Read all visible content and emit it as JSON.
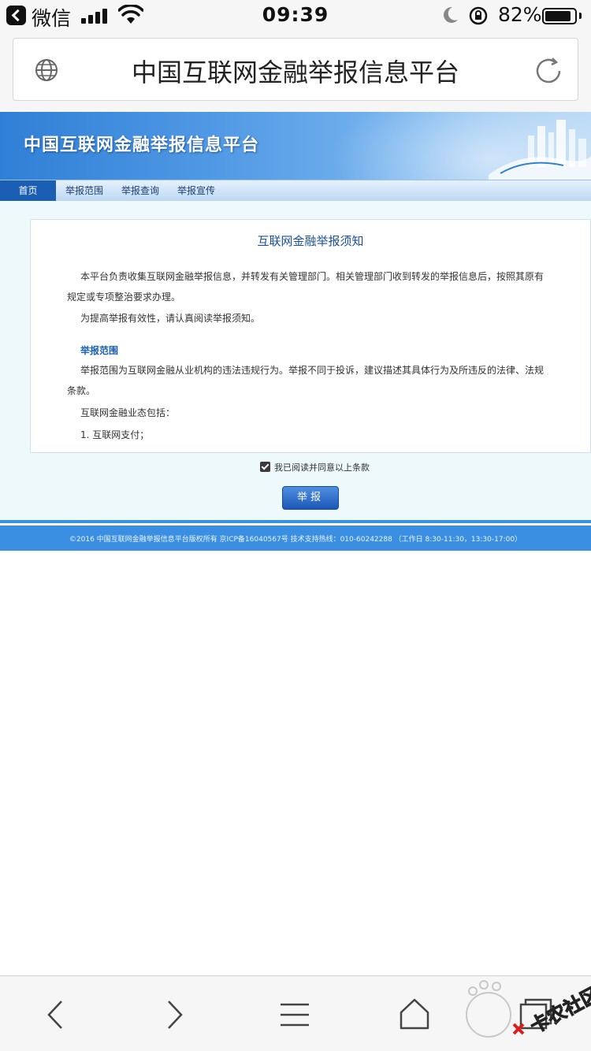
{
  "status_bar": {
    "carrier": "微信",
    "time": "09:39",
    "battery_percent": "82%"
  },
  "address_bar": {
    "title": "中国互联网金融举报信息平台"
  },
  "banner": {
    "title": "中国互联网金融举报信息平台"
  },
  "nav": {
    "items": [
      "首页",
      "举报范围",
      "举报查询",
      "举报宣传"
    ],
    "active_index": 0
  },
  "notice": {
    "title": "互联网金融举报须知",
    "para1_line1": "本平台负责收集互联网金融举报信息，并转发有关管理部门。相关管理部门收到转发的举报信息后，按照其原有",
    "para1_line2": "规定或专项整治要求办理。",
    "para2": "为提高举报有效性，请认真阅读举报须知。",
    "section_heading": "举报范围",
    "para3_line1": "举报范围为互联网金融从业机构的违法违规行为。举报不同于投诉，建议描述其具体行为及所违反的法律、法规",
    "para3_line2": "条款。",
    "para4": "互联网金融业态包括：",
    "list_item1": "1. 互联网支付；"
  },
  "agree": {
    "label": "我已阅读并同意以上条款",
    "checked": true
  },
  "report_button": {
    "label": "举报"
  },
  "footer": {
    "text": "©2016 中国互联网金融举报信息平台版权所有 京ICP备16040567号 技术支持热线：010-60242288 （工作日 8:30-11:30，13:30-17:00）"
  },
  "toolbar": {
    "icons": [
      "back-icon",
      "forward-icon",
      "menu-icon",
      "home-icon",
      "tabs-icon"
    ]
  },
  "watermark": {
    "text": "卡农社区"
  },
  "colors": {
    "accent": "#1a5fb4",
    "footer": "#3a8fe2",
    "content_bg": "#eef9fb"
  }
}
